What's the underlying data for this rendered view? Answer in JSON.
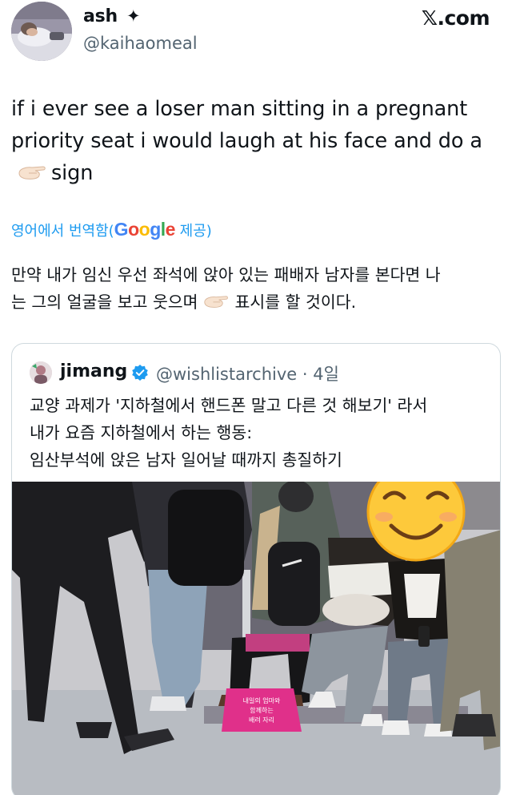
{
  "author": {
    "display_name": "ash",
    "name_badge": "✦",
    "handle": "@kaihaomeal",
    "avatar_icon": "profile-photo"
  },
  "site": {
    "label": "𝕏.com"
  },
  "tweet": {
    "line1": "if i ever see a loser man sitting in a pregnant",
    "line2": "priority seat i would laugh at his face and do a",
    "line3_after_emoji": "sign",
    "emoji": "pinching-hand-emoji"
  },
  "translation_note": {
    "prefix": "영어에서 번역함(",
    "google": [
      "G",
      "o",
      "o",
      "g",
      "l",
      "e"
    ],
    "suffix": " 제공)",
    "google_colors": [
      "#4285f4",
      "#ea4335",
      "#fbbc05",
      "#4285f4",
      "#34a853",
      "#ea4335"
    ]
  },
  "translation": {
    "line1": "만약 내가 임신 우선 좌석에 앉아 있는 패배자 남자를 본다면 나",
    "line2_before_emoji": "는 그의 얼굴을 보고 웃으며",
    "line2_after_emoji": "표시를 할 것이다."
  },
  "quoted_tweet": {
    "display_name": "jimang",
    "verified_icon": "verified-badge-icon",
    "handle_date": "@wishlistarchive · 4일",
    "line1": "교양 과제가 '지하철에서 핸드폰 말고 다른 것 해보기' 라서",
    "line2": "내가 요즘 지하철에서 하는 행동:",
    "line3": "임산부석에 앉은 남자 일어날 때까지 총질하기",
    "photo": "subway-car-photo",
    "face_cover_emoji": "smiling-face-emoji",
    "seat_sign_text": [
      "내일의 엄마와",
      "함께하는",
      "배려 자리"
    ]
  },
  "colors": {
    "text": "#0f1419",
    "secondary": "#536471",
    "link": "#1d9bf0",
    "border": "#cfd9de",
    "seat_pink": "#e0308a"
  }
}
